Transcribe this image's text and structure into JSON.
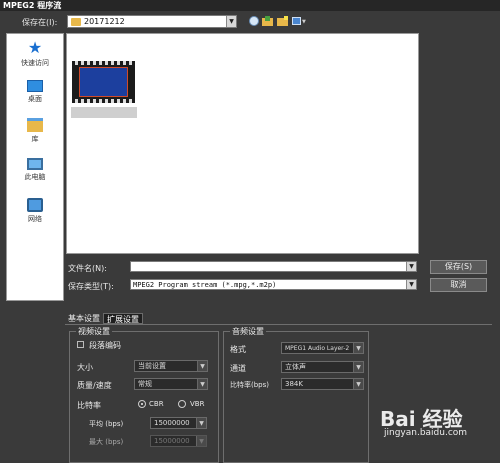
{
  "window": {
    "title": "MPEG2 程序流"
  },
  "save_in": {
    "label": "保存在(I):",
    "value": "20171212"
  },
  "sidebar": {
    "items": [
      {
        "label": "快速访问",
        "icon": "star-icon"
      },
      {
        "label": "桌面",
        "icon": "desktop-icon"
      },
      {
        "label": "库",
        "icon": "library-icon"
      },
      {
        "label": "此电脑",
        "icon": "computer-icon"
      },
      {
        "label": "网络",
        "icon": "network-icon"
      }
    ]
  },
  "file_pane": {
    "items": [
      {
        "name": ""
      }
    ]
  },
  "filename": {
    "label": "文件名(N):",
    "value": ""
  },
  "filetype": {
    "label": "保存类型(T):",
    "value": "MPEG2 Program stream (*.mpg,*.m2p)"
  },
  "buttons": {
    "save": "保存(S)",
    "cancel": "取消"
  },
  "tabs": {
    "basic": "基本设置",
    "extended": "扩展设置"
  },
  "video": {
    "group_title": "视频设置",
    "segment_encoding": "段落编码",
    "size_label": "大小",
    "size_value": "当前设置",
    "quality_label": "质量/速度",
    "quality_value": "常规",
    "bitrate_label": "比特率",
    "cbr": "CBR",
    "vbr": "VBR",
    "avg_label": "平均 (bps)",
    "avg_value": "15000000",
    "max_label": "最大 (bps)",
    "max_value": "15000000"
  },
  "audio": {
    "group_title": "音频设置",
    "format_label": "格式",
    "format_value": "MPEG1 Audio Layer-2",
    "channel_label": "通道",
    "channel_value": "立体声",
    "bitrate_label": "比特率(bps)",
    "bitrate_value": "384K"
  },
  "watermark": {
    "brand": "Bai 经验",
    "url": "jingyan.baidu.com"
  },
  "colors": {
    "background": "#3a3a3a",
    "titlebar": "#262626",
    "pane": "#ffffff",
    "link_blue": "#1a6fd0",
    "folder_yellow": "#e8b84a"
  }
}
